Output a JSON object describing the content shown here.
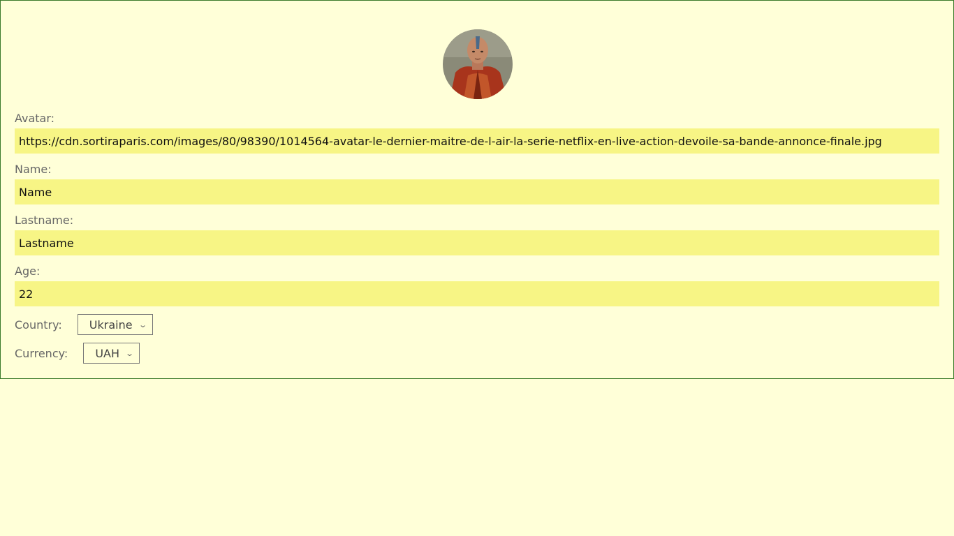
{
  "profile": {
    "avatar_label": "Avatar:",
    "avatar_value": "https://cdn.sortiraparis.com/images/80/98390/1014564-avatar-le-dernier-maitre-de-l-air-la-serie-netflix-en-live-action-devoile-sa-bande-annonce-finale.jpg",
    "name_label": "Name:",
    "name_value": "Name",
    "lastname_label": "Lastname:",
    "lastname_value": "Lastname",
    "age_label": "Age:",
    "age_value": "22",
    "country_label": "Country:",
    "country_selected": "Ukraine",
    "currency_label": "Currency:",
    "currency_selected": "UAH"
  },
  "icons": {
    "dropdown": "chevron-down-icon"
  },
  "colors": {
    "page_background": "#ffffd8",
    "input_background": "#f7f585",
    "card_border": "#3a7a2a"
  }
}
